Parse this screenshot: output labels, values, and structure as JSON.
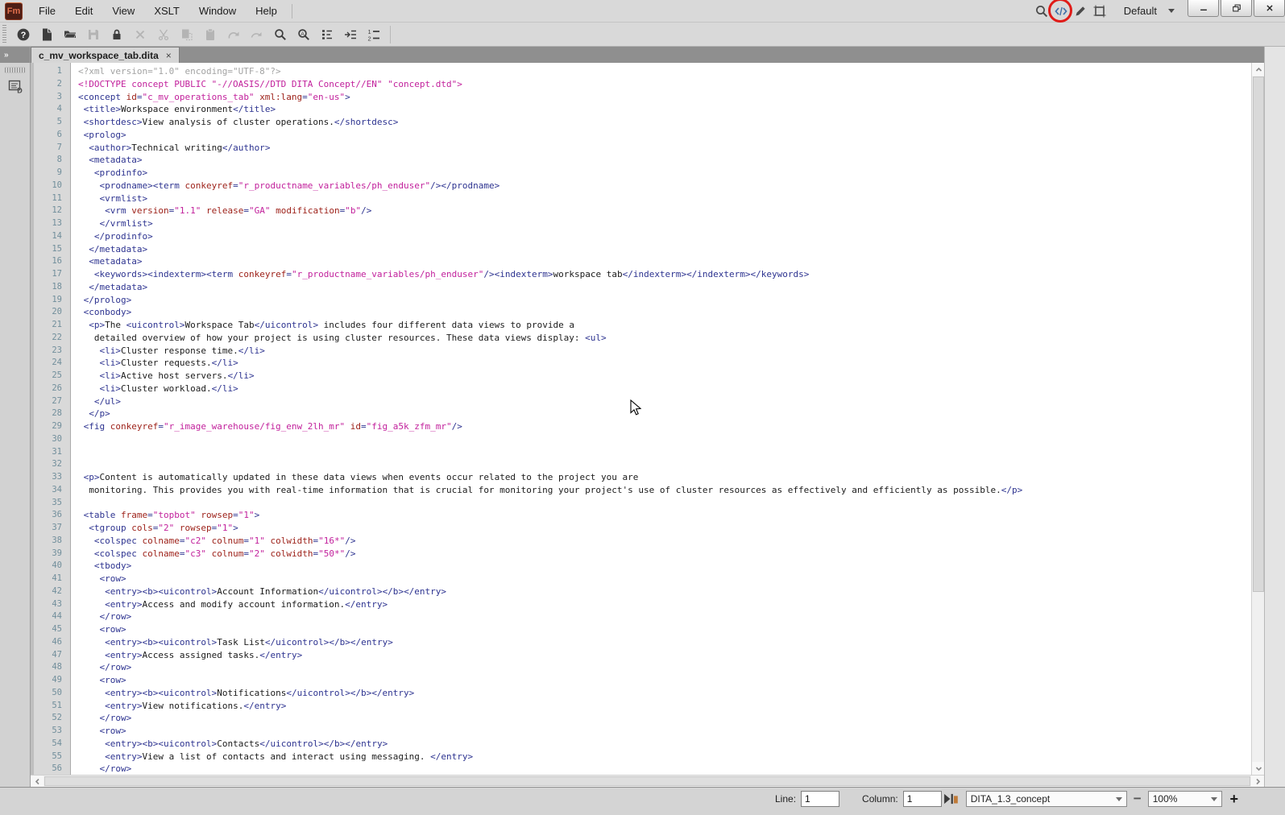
{
  "app": {
    "logo_text": "Fm"
  },
  "menu_bar": {
    "items": [
      "File",
      "Edit",
      "View",
      "XSLT",
      "Window",
      "Help"
    ]
  },
  "toolbar": {
    "buttons": [
      {
        "name": "help",
        "enabled": true
      },
      {
        "name": "new-document",
        "enabled": true
      },
      {
        "name": "open",
        "enabled": true
      },
      {
        "name": "save",
        "enabled": false
      },
      {
        "name": "lock",
        "enabled": true
      },
      {
        "name": "delete",
        "enabled": false
      },
      {
        "name": "cut",
        "enabled": false
      },
      {
        "name": "paste-special",
        "enabled": false
      },
      {
        "name": "paste",
        "enabled": false
      },
      {
        "name": "redo",
        "enabled": false
      },
      {
        "name": "step-forward",
        "enabled": false
      },
      {
        "name": "find",
        "enabled": true
      },
      {
        "name": "find-change",
        "enabled": true
      },
      {
        "name": "element-catalog",
        "enabled": true
      },
      {
        "name": "smart-insert",
        "enabled": true
      },
      {
        "name": "numbered-list",
        "enabled": true
      }
    ]
  },
  "top_right": {
    "icons": [
      "search",
      "code-view",
      "format-pen",
      "text-frame"
    ],
    "annotated_icon": "code-view",
    "workspace_selector": "Default",
    "window_buttons": [
      "minimize",
      "restore",
      "close"
    ]
  },
  "left_rail": {
    "expand_glyph": "»",
    "panel_icon": "document-outline"
  },
  "tab": {
    "label": "c_mv_workspace_tab.dita",
    "close_glyph": "×"
  },
  "editor": {
    "lines": [
      "<?xml version=\"1.0\" encoding=\"UTF-8\"?>",
      "<!DOCTYPE concept PUBLIC \"-//OASIS//DTD DITA Concept//EN\" \"concept.dtd\">",
      "<concept id=\"c_mv_operations_tab\" xml:lang=\"en-us\">",
      " <title>Workspace environment</title>",
      " <shortdesc>View analysis of cluster operations.</shortdesc>",
      " <prolog>",
      "  <author>Technical writing</author>",
      "  <metadata>",
      "   <prodinfo>",
      "    <prodname><term conkeyref=\"r_productname_variables/ph_enduser\"/></prodname>",
      "    <vrmlist>",
      "     <vrm version=\"1.1\" release=\"GA\" modification=\"b\"/>",
      "    </vrmlist>",
      "   </prodinfo>",
      "  </metadata>",
      "  <metadata>",
      "   <keywords><indexterm><term conkeyref=\"r_productname_variables/ph_enduser\"/><indexterm>workspace tab</indexterm></indexterm></keywords>",
      "  </metadata>",
      " </prolog>",
      " <conbody>",
      "  <p>The <uicontrol>Workspace Tab</uicontrol> includes four different data views to provide a",
      "   detailed overview of how your project is using cluster resources. These data views display: <ul>",
      "    <li>Cluster response time.</li>",
      "    <li>Cluster requests.</li>",
      "    <li>Active host servers.</li>",
      "    <li>Cluster workload.</li>",
      "   </ul>",
      "  </p>",
      " <fig conkeyref=\"r_image_warehouse/fig_enw_2lh_mr\" id=\"fig_a5k_zfm_mr\"/>",
      "",
      "",
      "",
      " <p>Content is automatically updated in these data views when events occur related to the project you are",
      "  monitoring. This provides you with real-time information that is crucial for monitoring your project's use of cluster resources as effectively and efficiently as possible.</p>",
      "",
      " <table frame=\"topbot\" rowsep=\"1\">",
      "  <tgroup cols=\"2\" rowsep=\"1\">",
      "   <colspec colname=\"c2\" colnum=\"1\" colwidth=\"16*\"/>",
      "   <colspec colname=\"c3\" colnum=\"2\" colwidth=\"50*\"/>",
      "   <tbody>",
      "    <row>",
      "     <entry><b><uicontrol>Account Information</uicontrol></b></entry>",
      "     <entry>Access and modify account information.</entry>",
      "    </row>",
      "    <row>",
      "     <entry><b><uicontrol>Task List</uicontrol></b></entry>",
      "     <entry>Access assigned tasks.</entry>",
      "    </row>",
      "    <row>",
      "     <entry><b><uicontrol>Notifications</uicontrol></b></entry>",
      "     <entry>View notifications.</entry>",
      "    </row>",
      "    <row>",
      "     <entry><b><uicontrol>Contacts</uicontrol></b></entry>",
      "     <entry>View a list of contacts and interact using messaging. </entry>",
      "    </row>"
    ]
  },
  "status_bar": {
    "line_label": "Line:",
    "line_value": "1",
    "column_label": "Column:",
    "column_value": "1",
    "doctype_selector": "DITA_1.3_concept",
    "zoom_out": "−",
    "zoom_value": "100%",
    "zoom_in": "+"
  },
  "colors": {
    "tag": "#2d3390",
    "attr_name": "#9c1f17",
    "attr_value": "#c2219c",
    "doctype": "#c2219c",
    "xml_prolog": "#a3a3a3",
    "plain_text": "#1b1b1b",
    "line_number": "#718e9b",
    "annotation_red": "#e01b18",
    "code_view_blue": "#3f6fa8"
  }
}
